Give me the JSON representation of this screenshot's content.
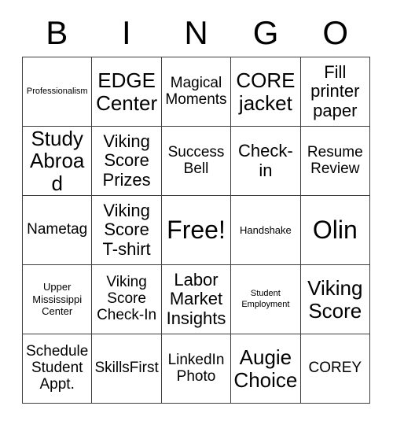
{
  "card": {
    "title_letters": [
      "B",
      "I",
      "N",
      "G",
      "O"
    ],
    "columns": 5,
    "rows": 5,
    "free_space": "Free!",
    "border_color": "#3d3d3d",
    "background_color": "#ffffff",
    "text_color": "#000000",
    "cells": [
      {
        "text": "Professionalism",
        "size": "s-xs"
      },
      {
        "text": "EDGE Center",
        "size": "s-xl"
      },
      {
        "text": "Magical Moments",
        "size": "s-md"
      },
      {
        "text": "CORE jacket",
        "size": "s-xl"
      },
      {
        "text": "Fill printer paper",
        "size": "s-lg"
      },
      {
        "text": "Study Abroad",
        "size": "s-xl"
      },
      {
        "text": "Viking Score Prizes",
        "size": "s-lg"
      },
      {
        "text": "Success Bell",
        "size": "s-md"
      },
      {
        "text": "Check-in",
        "size": "s-lg"
      },
      {
        "text": "Resume Review",
        "size": "s-md"
      },
      {
        "text": "Nametag",
        "size": "s-md"
      },
      {
        "text": "Viking Score T-shirt",
        "size": "s-lg"
      },
      {
        "text": "Free!",
        "size": "s-xxl"
      },
      {
        "text": "Handshake",
        "size": "s-sm"
      },
      {
        "text": "Olin",
        "size": "s-xxl"
      },
      {
        "text": "Upper Mississippi Center",
        "size": "s-sm"
      },
      {
        "text": "Viking Score Check-In",
        "size": "s-md"
      },
      {
        "text": "Labor Market Insights",
        "size": "s-lg"
      },
      {
        "text": "Student Employment",
        "size": "s-xs"
      },
      {
        "text": "Viking Score",
        "size": "s-xl"
      },
      {
        "text": "Schedule Student Appt.",
        "size": "s-md"
      },
      {
        "text": "SkillsFirst",
        "size": "s-md"
      },
      {
        "text": "LinkedIn Photo",
        "size": "s-md"
      },
      {
        "text": "Augie Choice",
        "size": "s-xl"
      },
      {
        "text": "COREY",
        "size": "s-md"
      }
    ]
  }
}
